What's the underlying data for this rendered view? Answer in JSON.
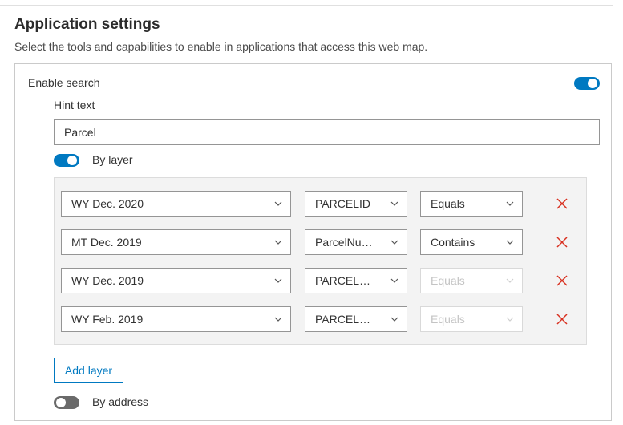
{
  "section": {
    "title": "Application settings",
    "description": "Select the tools and capabilities to enable in applications that access this web map."
  },
  "search": {
    "label": "Enable search",
    "enabled": true,
    "hint_label": "Hint text",
    "hint_value": "Parcel",
    "by_layer": {
      "label": "By layer",
      "enabled": true
    },
    "layers": [
      {
        "layer": "WY Dec. 2020",
        "field": "PARCELID",
        "operator": "Equals",
        "operator_enabled": true
      },
      {
        "layer": "MT Dec. 2019",
        "field": "ParcelNu…",
        "operator": "Contains",
        "operator_enabled": true
      },
      {
        "layer": "WY Dec. 2019",
        "field": "PARCEL…",
        "operator": "Equals",
        "operator_enabled": false
      },
      {
        "layer": "WY Feb. 2019",
        "field": "PARCEL…",
        "operator": "Equals",
        "operator_enabled": false
      }
    ],
    "add_layer_label": "Add layer",
    "by_address": {
      "label": "By address",
      "enabled": false
    }
  },
  "icons": {
    "chevron": "chevron-down-icon",
    "delete": "close-icon"
  },
  "colors": {
    "accent": "#0079c1",
    "delete": "#d83020",
    "toggle_off": "#6a6a6a"
  }
}
